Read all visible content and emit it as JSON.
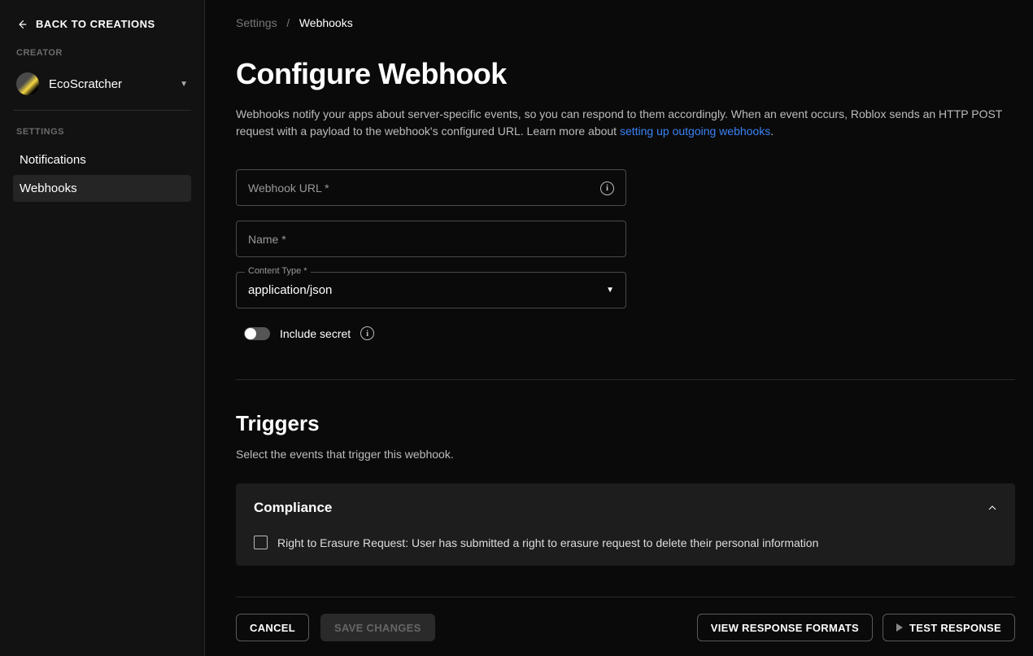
{
  "sidebar": {
    "back_label": "BACK TO CREATIONS",
    "creator_section": "CREATOR",
    "creator_name": "EcoScratcher",
    "settings_section": "SETTINGS",
    "nav": [
      "Notifications",
      "Webhooks"
    ]
  },
  "breadcrumb": {
    "parent": "Settings",
    "sep": "/",
    "current": "Webhooks"
  },
  "page": {
    "title": "Configure Webhook",
    "intro_a": "Webhooks notify your apps about server-specific events, so you can respond to them accordingly. When an event occurs, Roblox sends an HTTP POST request with a payload to the webhook's configured URL. Learn more about ",
    "intro_link": "setting up outgoing webhooks",
    "intro_b": "."
  },
  "form": {
    "url_label": "Webhook URL *",
    "name_label": "Name *",
    "content_type_label": "Content Type *",
    "content_type_value": "application/json",
    "include_secret": "Include secret"
  },
  "triggers": {
    "title": "Triggers",
    "subtitle": "Select the events that trigger this webhook.",
    "panel_title": "Compliance",
    "item": "Right to Erasure Request: User has submitted a right to erasure request to delete their personal information"
  },
  "footer": {
    "cancel": "CANCEL",
    "save": "SAVE CHANGES",
    "view_formats": "VIEW RESPONSE FORMATS",
    "test": "TEST RESPONSE"
  }
}
